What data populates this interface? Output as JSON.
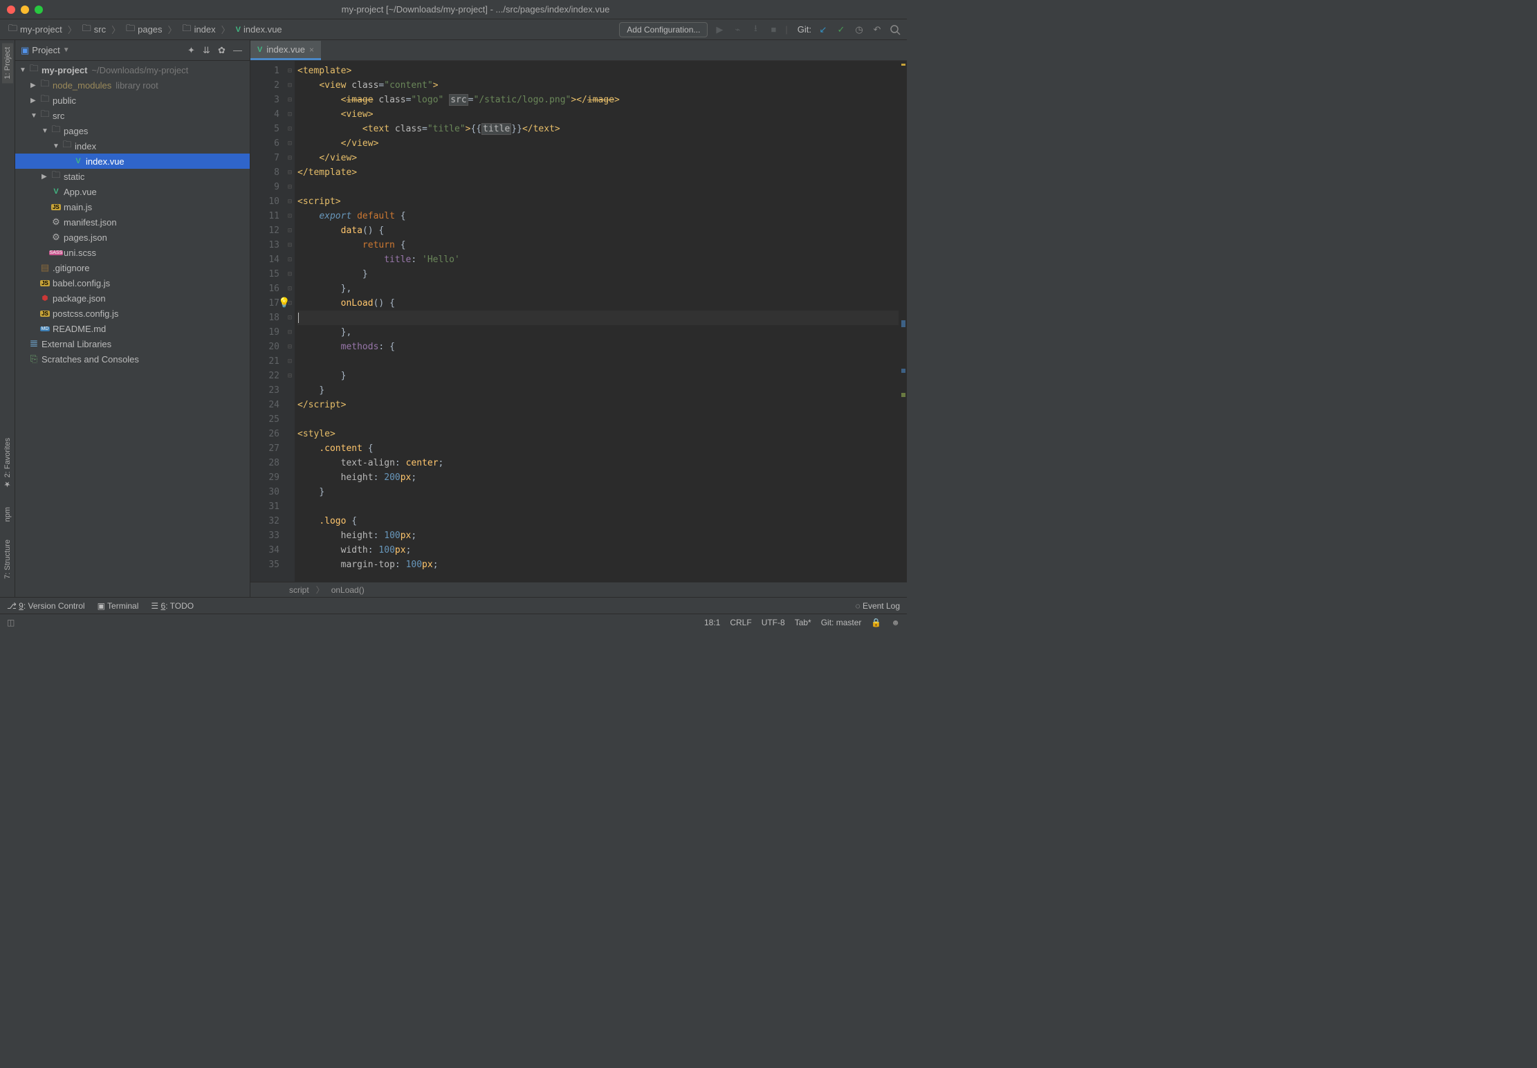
{
  "window": {
    "title": "my-project [~/Downloads/my-project] - .../src/pages/index/index.vue"
  },
  "breadcrumbs": [
    {
      "icon": "folder",
      "label": "my-project"
    },
    {
      "icon": "folder",
      "label": "src"
    },
    {
      "icon": "folder",
      "label": "pages"
    },
    {
      "icon": "folder",
      "label": "index"
    },
    {
      "icon": "vue",
      "label": "index.vue"
    }
  ],
  "toolbar": {
    "add_config": "Add Configuration...",
    "git_label": "Git:"
  },
  "left_tabs": {
    "project": "1: Project",
    "favorites": "2: Favorites",
    "npm": "npm",
    "structure": "7: Structure"
  },
  "project_panel": {
    "title": "Project"
  },
  "tree": {
    "root": {
      "label": "my-project",
      "path": "~/Downloads/my-project"
    },
    "node_modules": {
      "label": "node_modules",
      "hint": "library root"
    },
    "public": "public",
    "src": "src",
    "pages": "pages",
    "index_dir": "index",
    "index_vue": "index.vue",
    "static": "static",
    "app_vue": "App.vue",
    "main_js": "main.js",
    "manifest": "manifest.json",
    "pages_json": "pages.json",
    "uni_scss": "uni.scss",
    "gitignore": ".gitignore",
    "babel": "babel.config.js",
    "package": "package.json",
    "postcss": "postcss.config.js",
    "readme": "README.md",
    "ext_lib": "External Libraries",
    "scratches": "Scratches and Consoles"
  },
  "editor": {
    "tab_label": "index.vue",
    "lines": [
      "1",
      "2",
      "3",
      "4",
      "5",
      "6",
      "7",
      "8",
      "9",
      "10",
      "11",
      "12",
      "13",
      "14",
      "15",
      "16",
      "17",
      "18",
      "19",
      "20",
      "21",
      "22",
      "23",
      "24",
      "25",
      "26",
      "27",
      "28",
      "29",
      "30",
      "31",
      "32",
      "33",
      "34",
      "35"
    ],
    "code": {
      "l1": {
        "tag": "template"
      },
      "l2": {
        "tag": "view",
        "attr": "class",
        "val": "\"content\""
      },
      "l3": {
        "tag": "image",
        "a1": "class",
        "v1": "\"logo\"",
        "a2": "src",
        "v2": "\"/static/logo.png\""
      },
      "l4": {
        "tag": "view"
      },
      "l5": {
        "tag": "text",
        "attr": "class",
        "val": "\"title\"",
        "expr": "title"
      },
      "l6": {
        "close": "view"
      },
      "l7": {
        "close": "view"
      },
      "l8": {
        "close": "template"
      },
      "l10": {
        "tag": "script"
      },
      "l11": {
        "kw1": "export ",
        "kw2": "default ",
        "p": "{"
      },
      "l12": {
        "fn": "data",
        "p": "() {"
      },
      "l13": {
        "kw": "return ",
        "p": "{"
      },
      "l14": {
        "prop": "title",
        "str": "'Hello'"
      },
      "l15": {
        "p": "}"
      },
      "l16": {
        "p": "},"
      },
      "l17": {
        "fn": "onLoad",
        "p": "() {"
      },
      "l19": {
        "p": "},"
      },
      "l20": {
        "prop": "methods",
        "p": ": {"
      },
      "l22": {
        "p": "}"
      },
      "l23": {
        "p": "}"
      },
      "l24": {
        "close": "script"
      },
      "l26": {
        "tag": "style"
      },
      "l27": {
        "sel": ".content ",
        "p": "{"
      },
      "l28": {
        "prop": "text-align",
        "val": "center"
      },
      "l29": {
        "prop": "height",
        "num": "200",
        "unit": "px"
      },
      "l30": {
        "p": "}"
      },
      "l32": {
        "sel": ".logo ",
        "p": "{"
      },
      "l33": {
        "prop": "height",
        "num": "100",
        "unit": "px"
      },
      "l34": {
        "prop": "width",
        "num": "100",
        "unit": "px"
      },
      "l35": {
        "prop": "margin-top",
        "num": "100",
        "unit": "px"
      }
    },
    "crumbs": {
      "a": "script",
      "b": "onLoad()"
    }
  },
  "bottom": {
    "vcs": "9: Version Control",
    "terminal": "Terminal",
    "todo": "6: TODO",
    "eventlog": "Event Log"
  },
  "status": {
    "pos": "18:1",
    "eol": "CRLF",
    "enc": "UTF-8",
    "indent": "Tab*",
    "git": "Git: master"
  }
}
